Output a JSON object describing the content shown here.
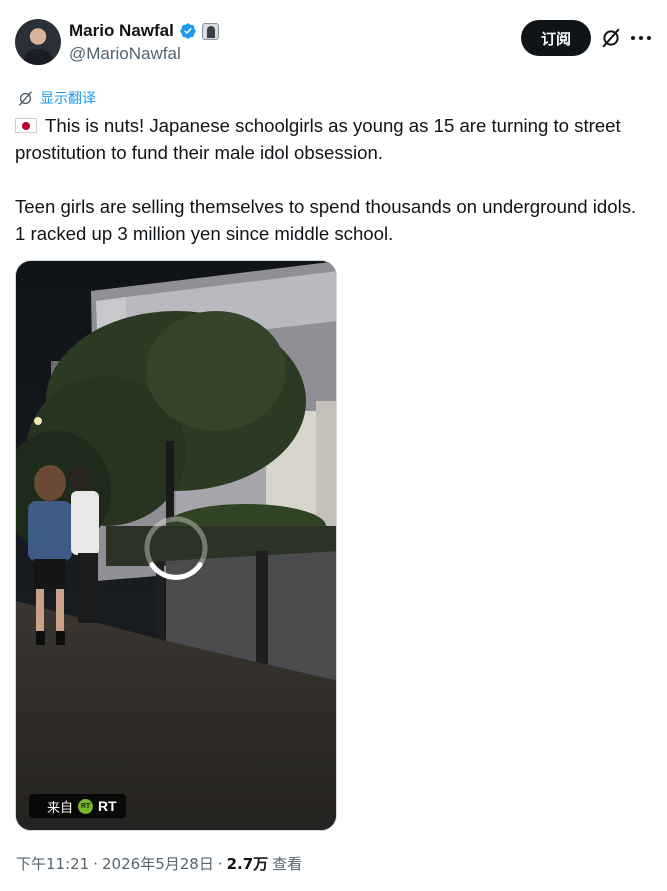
{
  "author": {
    "display_name": "Mario Nawfal",
    "handle": "@MarioNawfal",
    "verified_icon": "verified-badge-icon",
    "affiliation_icon": "affiliate-badge-icon"
  },
  "header": {
    "subscribe_label": "订阅",
    "grok_icon": "grok-icon",
    "more_icon": "more-options-icon"
  },
  "translate": {
    "label": "显示翻译",
    "icon": "translate-icon"
  },
  "tweet": {
    "paragraph1_flag": "japan-flag-emoji",
    "paragraph1": "This is nuts! Japanese schoolgirls as young as 15 are turning to street prostitution to fund their male idol obsession.",
    "paragraph2": "Teen girls are selling themselves to spend thousands on underground idols. 1 racked up 3 million yen since middle school."
  },
  "media": {
    "type": "video",
    "loading": true,
    "source_prefix": "来自",
    "source_logo": "RT",
    "source_name": "RT"
  },
  "meta": {
    "time": "下午11:21",
    "separator1": "·",
    "date": "2026年5月28日",
    "separator2": "·",
    "views_count": "2.7万",
    "views_label": "查看"
  },
  "colors": {
    "link_blue": "#1d9bf0",
    "text_primary": "#0f1419",
    "text_secondary": "#536471",
    "button_bg": "#0f1419"
  }
}
